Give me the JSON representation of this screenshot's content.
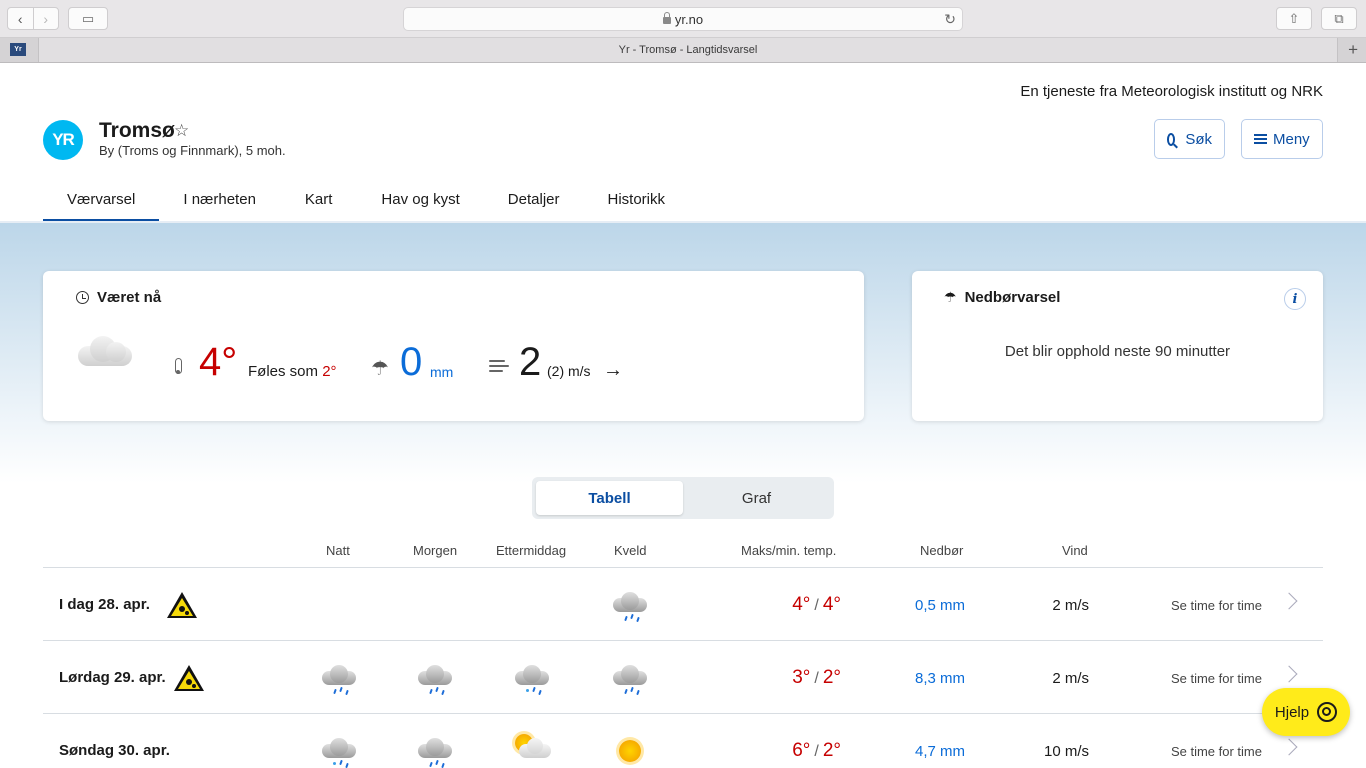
{
  "browser": {
    "url": "yr.no",
    "tab_title": "Yr - Tromsø - Langtidsvarsel",
    "favicon_text": "Yr"
  },
  "header": {
    "service_text": "En tjeneste fra Meteorologisk institutt og NRK",
    "logo_text": "YR",
    "place_name": "Tromsø",
    "place_sub": "By (Troms og Finnmark), 5 moh.",
    "search_label": "Søk",
    "menu_label": "Meny"
  },
  "nav": {
    "items": [
      "Værvarsel",
      "I nærheten",
      "Kart",
      "Hav og kyst",
      "Detaljer",
      "Historikk"
    ],
    "active": "Værvarsel"
  },
  "now": {
    "title": "Været nå",
    "temperature": "4°",
    "feels_label": "Føles som",
    "feels_value": "2°",
    "precip_value": "0",
    "precip_unit": "mm",
    "wind_value": "2",
    "wind_gust": "(2) m/s",
    "wind_arrow": "→"
  },
  "precip_forecast": {
    "title": "Nedbørvarsel",
    "info_label": "i",
    "text": "Det blir opphold neste 90 minutter"
  },
  "view_toggle": {
    "selected": "Tabell",
    "other": "Graf"
  },
  "table": {
    "headers": {
      "natt": "Natt",
      "morgen": "Morgen",
      "ettermiddag": "Ettermiddag",
      "kveld": "Kveld",
      "temp": "Maks/min. temp.",
      "precip": "Nedbør",
      "wind": "Vind"
    },
    "link_label": "Se time for time",
    "rows": [
      {
        "day": "I dag 28. apr.",
        "warning": true,
        "icons": [
          "",
          "",
          "",
          "rain"
        ],
        "max": "4°",
        "min": "4°",
        "precip": "0,5 mm",
        "wind": "2 m/s"
      },
      {
        "day": "Lørdag 29. apr.",
        "warning": true,
        "icons": [
          "rain",
          "rain",
          "sleet",
          "rain"
        ],
        "max": "3°",
        "min": "2°",
        "precip": "8,3 mm",
        "wind": "2 m/s"
      },
      {
        "day": "Søndag 30. apr.",
        "warning": false,
        "icons": [
          "sleet",
          "rain",
          "partly-cloudy",
          "sun"
        ],
        "max": "6°",
        "min": "2°",
        "precip": "4,7 mm",
        "wind": "10 m/s"
      }
    ]
  },
  "help": {
    "label": "Hjelp"
  }
}
